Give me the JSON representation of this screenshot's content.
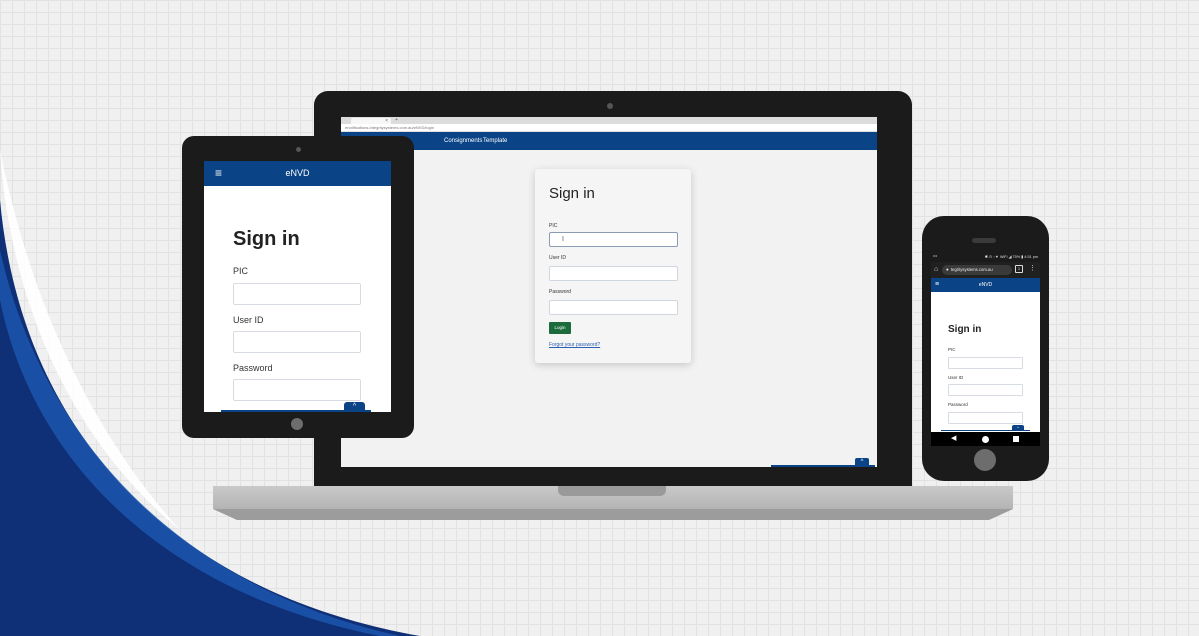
{
  "colors": {
    "brand_blue": "#0b4486",
    "login_green": "#1b6b3c",
    "device_body": "#1b1b1b",
    "link_blue": "#2b5fb0"
  },
  "laptop": {
    "tab_close": "×",
    "tab_new": "+",
    "url": "enotifications-integritysystems.com.au/eNVD/login",
    "nav_links": [
      "Consignments",
      "Template"
    ],
    "title": "Sign in",
    "pic_label": "PIC",
    "user_id_label": "User ID",
    "password_label": "Password",
    "login_button": "Login",
    "forgot_link": "Forgot your password?",
    "scroll_top_icon": "chevron-up-icon"
  },
  "tablet": {
    "brand": "eNVD",
    "menu_icon": "hamburger-menu-icon",
    "title": "Sign in",
    "pic_label": "PIC",
    "user_id_label": "User ID",
    "password_label": "Password",
    "scroll_top_icon": "chevron-up-icon"
  },
  "phone": {
    "status_left": "•••",
    "status_right": "✱ ⊙ ↑▼ WiFi ◢ 75% ▮ 4:51 pm",
    "url": "tegritysystems.com.au",
    "tabs_count": "1",
    "brand": "eNVD",
    "menu_icon": "hamburger-menu-icon",
    "title": "Sign in",
    "pic_label": "PIC",
    "user_id_label": "User ID",
    "password_label": "Password",
    "scroll_top_icon": "chevron-up-icon"
  }
}
